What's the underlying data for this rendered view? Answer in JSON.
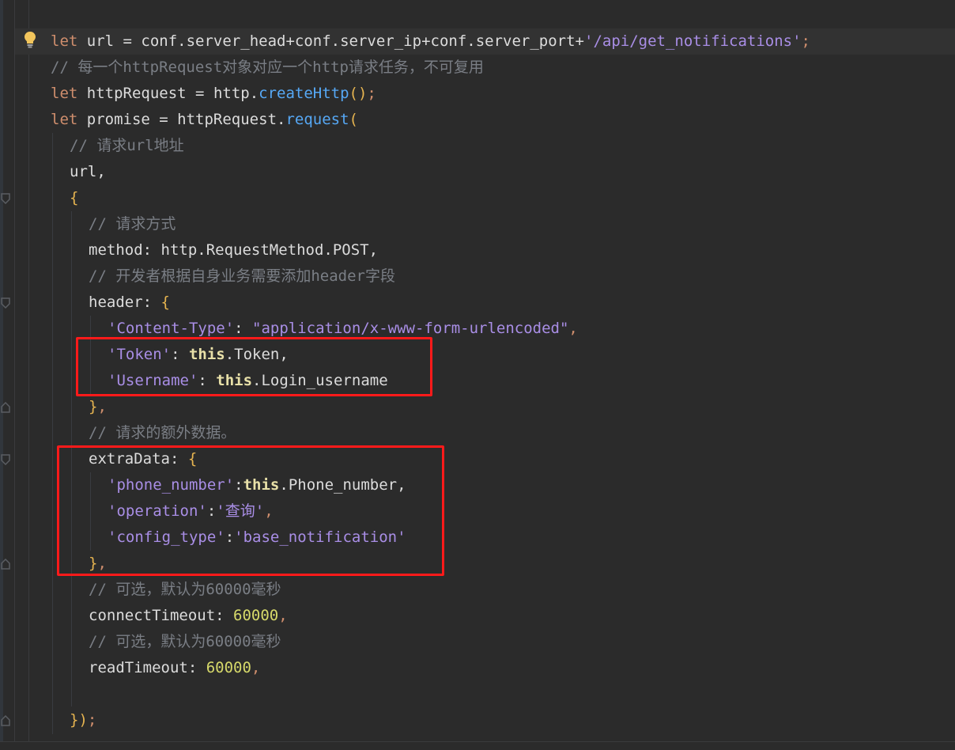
{
  "editor": {
    "lines": [
      [
        "let",
        " url ",
        "=",
        " conf.server_head",
        "+",
        "conf.server_ip",
        "+",
        "conf.server_port",
        "+",
        "'/api/get_notifications'",
        ";"
      ],
      [
        "// 每一个httpRequest对象对应一个http请求任务，不可复用"
      ],
      [
        "let",
        " httpRequest ",
        "=",
        " http.",
        "createHttp",
        "()",
        ";"
      ],
      [
        "let",
        " promise ",
        "=",
        " httpRequest.",
        "request",
        "("
      ],
      [
        "// 请求url地址"
      ],
      [
        "url,"
      ],
      [
        "{"
      ],
      [
        "// 请求方式"
      ],
      [
        "method: http.RequestMethod.POST,"
      ],
      [
        "// 开发者根据自身业务需要添加header字段"
      ],
      [
        "header: ",
        "{"
      ],
      [
        "'Content-Type'",
        ": ",
        "\"application/x-www-form-urlencoded\"",
        ","
      ],
      [
        "'Token'",
        ": ",
        "this",
        ".Token,"
      ],
      [
        "'Username'",
        ": ",
        "this",
        ".Login_username"
      ],
      [
        "}",
        ","
      ],
      [
        "// 请求的额外数据。"
      ],
      [
        "extraData: ",
        "{"
      ],
      [
        "'phone_number'",
        ":",
        "this",
        ".Phone_number,"
      ],
      [
        "'operation'",
        ":",
        "'查询'",
        ","
      ],
      [
        "'config_type'",
        ":",
        "'base_notification'"
      ],
      [
        "}",
        ","
      ],
      [
        "// 可选，默认为60000毫秒"
      ],
      [
        "connectTimeout: ",
        "60000",
        ","
      ],
      [
        "// 可选，默认为60000毫秒"
      ],
      [
        "readTimeout: ",
        "60000",
        ","
      ],
      [
        ""
      ],
      [
        "})",
        ";"
      ]
    ]
  },
  "colors": {
    "background": "#2b2b2b",
    "highlight_box": "#ff1a1a",
    "keyword": "#cf8e6d",
    "string": "#c77dbb",
    "comment": "#7a7e85",
    "number": "#d6d96a",
    "method": "#56a8f5"
  },
  "icons": {
    "gutter": "lightbulb-icon",
    "fold": "fold-marker-icon"
  }
}
